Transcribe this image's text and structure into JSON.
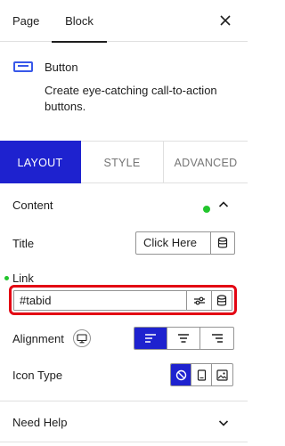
{
  "top_tabs": {
    "page": "Page",
    "block": "Block"
  },
  "block": {
    "name": "Button",
    "description": "Create eye-catching call-to-action buttons.",
    "icon": "button-block-icon"
  },
  "panel_tabs": {
    "layout": "LAYOUT",
    "style": "STYLE",
    "advanced": "ADVANCED",
    "active": "LAYOUT"
  },
  "content_section": {
    "title": "Content",
    "title_field": {
      "label": "Title",
      "value": "Click Here"
    },
    "link_field": {
      "label": "Link",
      "value": "#tabid"
    },
    "alignment": {
      "label": "Alignment",
      "options": [
        "left",
        "center",
        "right"
      ],
      "selected": "left"
    },
    "icon_type": {
      "label": "Icon Type",
      "options": [
        "none",
        "icon",
        "image"
      ],
      "selected": "none"
    }
  },
  "help_section": {
    "title": "Need Help"
  },
  "colors": {
    "accent": "#1e22cf",
    "highlight": "#e30613",
    "status": "#22c52d",
    "block_icon": "#3858e9"
  }
}
